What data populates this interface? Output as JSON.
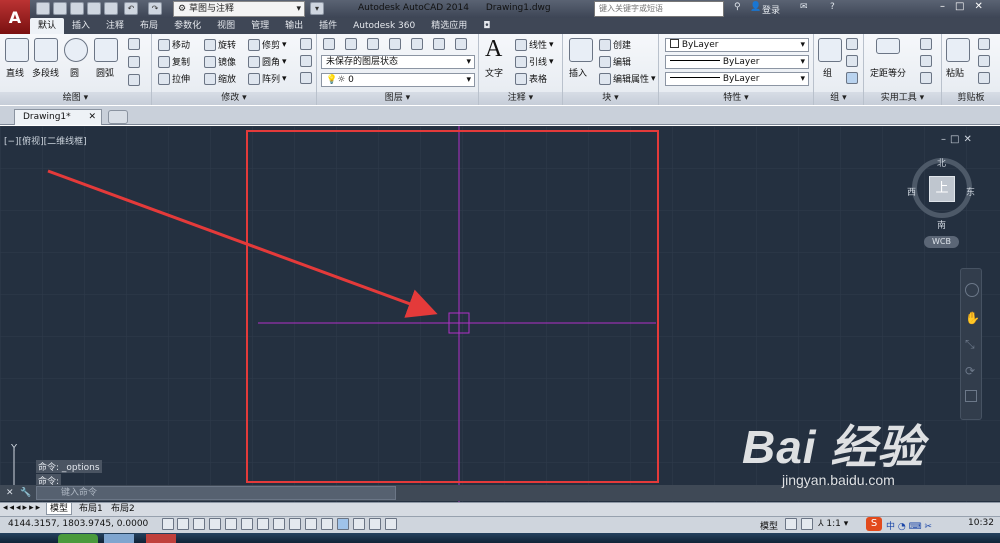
{
  "title_bar": {
    "app_title": "Autodesk AutoCAD 2014",
    "document_title": "Drawing1.dwg",
    "workspace": "草图与注释",
    "search_placeholder": "键入关键字或短语",
    "login_label": "登录"
  },
  "ribbon_tabs": [
    "默认",
    "插入",
    "注释",
    "布局",
    "参数化",
    "视图",
    "管理",
    "输出",
    "插件",
    "Autodesk 360",
    "精选应用"
  ],
  "ribbon": {
    "draw": {
      "label": "绘图",
      "line": "直线",
      "polyline": "多段线",
      "circle": "圆",
      "arc": "圆弧"
    },
    "modify": {
      "label": "修改",
      "move": "移动",
      "rotate": "旋转",
      "trim": "修剪",
      "copy": "复制",
      "mirror": "镜像",
      "fillet": "圆角",
      "stretch": "拉伸",
      "scale": "缩放",
      "array": "阵列"
    },
    "layers": {
      "label": "图层",
      "layer_state": "未保存的图层状态",
      "current_layer": "0"
    },
    "annotation": {
      "label": "注释",
      "text": "文字",
      "linear": "线性",
      "leader": "引线",
      "table": "表格"
    },
    "block": {
      "label": "块",
      "insert": "插入",
      "create": "创建",
      "edit": "编辑",
      "edit_attr": "编辑属性"
    },
    "properties": {
      "label": "特性",
      "color": "ByLayer",
      "linetype": "ByLayer",
      "lineweight": "ByLayer"
    },
    "groups": {
      "label": "组",
      "group": "组"
    },
    "utilities": {
      "label": "实用工具",
      "measure": "定距等分"
    },
    "clipboard": {
      "label": "剪贴板",
      "paste": "粘贴"
    }
  },
  "document_tab": "Drawing1*",
  "viewport": {
    "view_label": "[−][俯视][二维线框]",
    "viewcube": {
      "north": "北",
      "south": "南",
      "east": "东",
      "west": "西",
      "top": "上",
      "wcs": "WCB"
    },
    "ucs_y": "Y"
  },
  "command": {
    "history": [
      "命令: _options",
      "命令:"
    ],
    "input_placeholder": "键入命令"
  },
  "layout_tabs": [
    "模型",
    "布局1",
    "布局2"
  ],
  "status": {
    "coordinates": "4144.3157, 1803.9745, 0.0000",
    "model_label": "模型",
    "scale": "1:1",
    "time": "10:32"
  },
  "watermark": {
    "logo": "Bai 经验",
    "url": "jingyan.baidu.com"
  },
  "colors": {
    "canvas": "#243040",
    "crosshair": "#b030c8",
    "highlight": "#e43a3a"
  }
}
